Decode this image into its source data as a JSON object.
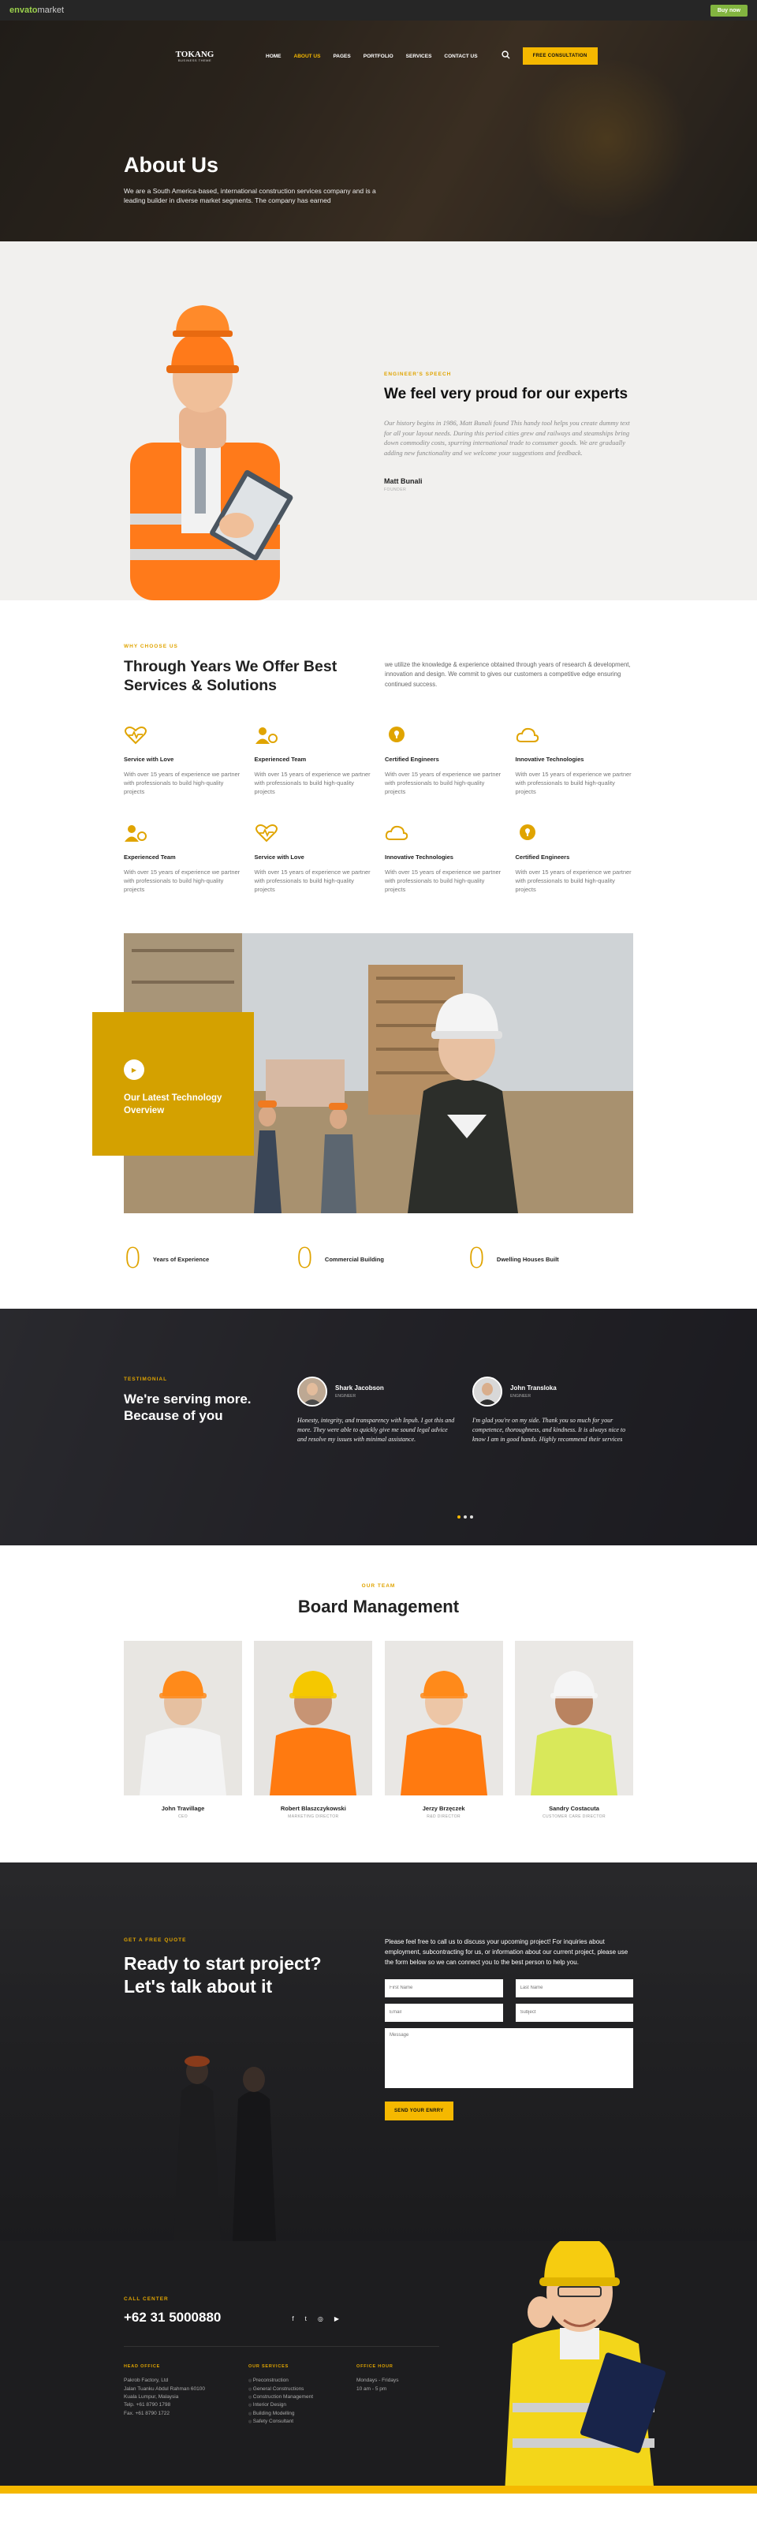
{
  "envato": {
    "logo_main": "envato",
    "logo_sub": "market",
    "buy_label": "Buy now"
  },
  "nav": {
    "brand": "TOKANG",
    "brand_sub": "BUSINESS THEME",
    "items": [
      "HOME",
      "ABOUT US",
      "PAGES",
      "PORTFOLIO",
      "SERVICES",
      "CONTACT US"
    ],
    "consult_label": "FREE CONSULTATION"
  },
  "hero": {
    "title": "About Us",
    "text": "We are a South America-based, international construction services company and is a leading builder in diverse market segments. The company has earned"
  },
  "speech": {
    "eyebrow": "ENGINEER'S SPEECH",
    "title": "We feel very proud for our experts",
    "quote": "Our history begins in 1986, Matt Bunali found This handy tool helps you create dummy text for all your layout needs. During this period cities grew and railways and steamships bring down commodity costs, spurring international trade to consumer goods. We are gradually adding new functionality and we welcome your suggestions and feedback.",
    "name": "Matt Bunali",
    "role": "FOUNDER"
  },
  "services": {
    "eyebrow": "WHY CHOOSE US",
    "title": "Through Years We Offer Best Services & Solutions",
    "intro": "we utilize the knowledge & experience obtained through years of research & development, innovation and design. We commit to gives our customers a competitive edge ensuring continued success.",
    "items": [
      {
        "icon": "heart-pulse",
        "title": "Service with Love",
        "text": "With over 15 years of experience we partner with professionals to build high-quality projects"
      },
      {
        "icon": "team",
        "title": "Experienced Team",
        "text": "With over 15 years of experience we partner with professionals to build high-quality projects"
      },
      {
        "icon": "lightbulb",
        "title": "Certified Engineers",
        "text": "With over 15 years of experience we partner with professionals to build high-quality projects"
      },
      {
        "icon": "cloud",
        "title": "Innovative Technologies",
        "text": "With over 15 years of experience we partner with professionals to build high-quality projects"
      },
      {
        "icon": "team",
        "title": "Experienced Team",
        "text": "With over 15 years of experience we partner with professionals to build high-quality projects"
      },
      {
        "icon": "heart-pulse",
        "title": "Service with Love",
        "text": "With over 15 years of experience we partner with professionals to build high-quality projects"
      },
      {
        "icon": "cloud",
        "title": "Innovative Technologies",
        "text": "With over 15 years of experience we partner with professionals to build high-quality projects"
      },
      {
        "icon": "lightbulb",
        "title": "Certified Engineers",
        "text": "With over 15 years of experience we partner with professionals to build high-quality projects"
      }
    ]
  },
  "video": {
    "title": "Our Latest Technology Overview"
  },
  "counters": [
    {
      "value": "0",
      "label": "Years of Experience"
    },
    {
      "value": "0",
      "label": "Commercial Building"
    },
    {
      "value": "0",
      "label": "Dwelling Houses Built"
    }
  ],
  "testimonial": {
    "eyebrow": "TESTIMONIAL",
    "title": "We're serving more. Because of you",
    "items": [
      {
        "name": "Shark Jacobson",
        "role": "ENGINEER",
        "text": "Honesty, integrity, and transparency with Inpuh. I got this and more. They were able to quickly give me sound legal advice and resolve my issues with minimal assistance."
      },
      {
        "name": "John Transloka",
        "role": "ENGINEER",
        "text": "I'm glad you're on my side. Thank you so much for your competence, thoroughness, and kindness. It is always nice to know I am in good hands. Highly recommend their services"
      }
    ]
  },
  "team": {
    "eyebrow": "OUR TEAM",
    "title": "Board Management",
    "members": [
      {
        "name": "John Travillage",
        "role": "CEO"
      },
      {
        "name": "Robert Blaszczykowski",
        "role": "MARKETING DIRECTOR"
      },
      {
        "name": "Jerzy Brzęczek",
        "role": "R&D DIRECTOR"
      },
      {
        "name": "Sandry Costacuta",
        "role": "CUSTOMER CARE DIRECTOR"
      }
    ]
  },
  "quote": {
    "eyebrow": "GET A FREE QUOTE",
    "title": "Ready to start project? Let's talk about it",
    "intro": "Please feel free to call us to discuss your upcoming project! For inquiries about employment, subcontracting for us, or information about our current project, please use the form below so we can connect you to the best person to help you.",
    "first_name": "First Name",
    "last_name": "Last Name",
    "email": "Email",
    "subject": "Subject",
    "message": "Message",
    "send_label": "SEND YOUR ENRRY"
  },
  "footer": {
    "call_label": "CALL CENTER",
    "phone": "+62 31 5000880",
    "head_office": {
      "title": "HEAD OFFICE",
      "lines": [
        "Pakrob Factory, Ltd",
        "Jalan Tuanku Abdul Rahman 60100",
        "Kuala Lumpur, Malaysia",
        "Telp. +61 8790 1798",
        "Fax. +61 8790 1722"
      ]
    },
    "services": {
      "title": "OUR SERVICES",
      "items": [
        "Preconstruction",
        "General Constructions",
        "Construction Management",
        "Interior Design",
        "Building Modelling",
        "Safety Consultant"
      ]
    },
    "hours": {
      "title": "OFFICE HOUR",
      "days": "Mondays - Fridays",
      "time": "10 am - 5 pm"
    }
  },
  "colors": {
    "accent": "#f5b800",
    "accent_dark": "#d4a100",
    "dark": "#1d1d1f"
  }
}
